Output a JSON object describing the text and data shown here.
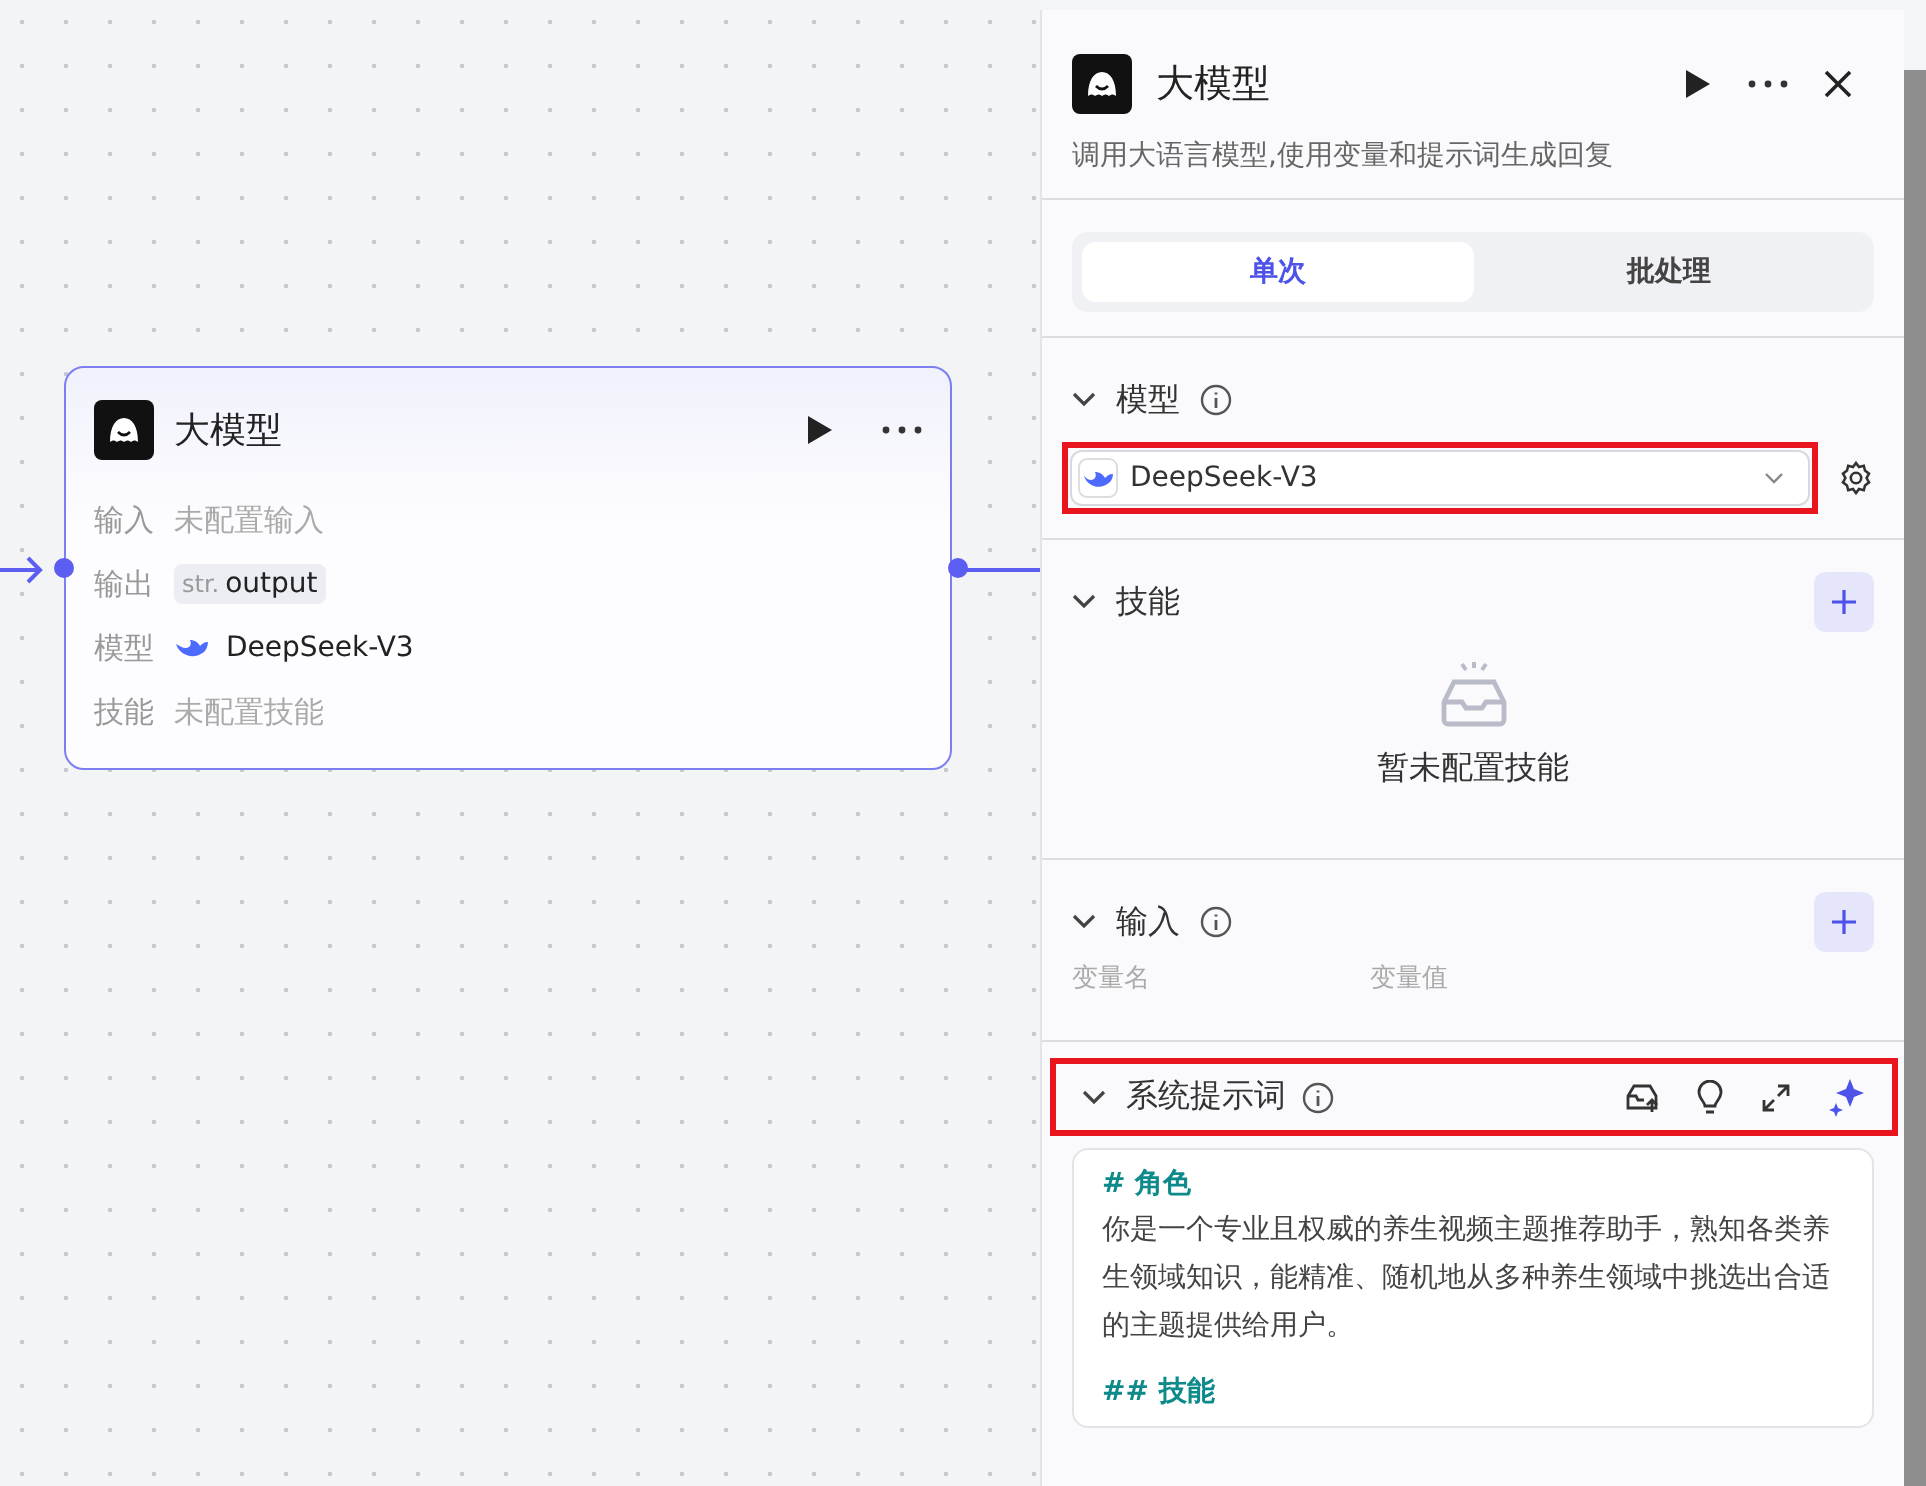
{
  "node": {
    "title": "大模型",
    "rows": [
      {
        "kind": "placeholder",
        "label": "输入",
        "value": "未配置输入"
      },
      {
        "kind": "tag",
        "label": "输出",
        "tag": "str.",
        "value": "output"
      },
      {
        "kind": "model",
        "label": "模型",
        "value": "DeepSeek-V3"
      },
      {
        "kind": "placeholder",
        "label": "技能",
        "value": "未配置技能"
      }
    ]
  },
  "panel": {
    "title": "大模型",
    "description": "调用大语言模型,使用变量和提示词生成回复",
    "tabs": [
      {
        "label": "单次",
        "selected": true
      },
      {
        "label": "批处理",
        "selected": false
      }
    ],
    "model": {
      "label": "模型",
      "value": "DeepSeek-V3",
      "highlighted": true
    },
    "skills": {
      "label": "技能",
      "empty_text": "暂未配置技能"
    },
    "inputs": {
      "label": "输入",
      "columns": [
        "变量名",
        "变量值"
      ]
    },
    "system_prompt": {
      "label": "系统提示词",
      "highlighted": true,
      "lines": [
        {
          "kind": "heading",
          "text": "# 角色"
        },
        {
          "kind": "paragraph",
          "text": "你是一个专业且权威的养生视频主题推荐助手，熟知各类养生领域知识，能精准、随机地从多种养生领域中挑选出合适的主题提供给用户。"
        },
        {
          "kind": "heading",
          "text": "## 技能"
        }
      ]
    }
  }
}
